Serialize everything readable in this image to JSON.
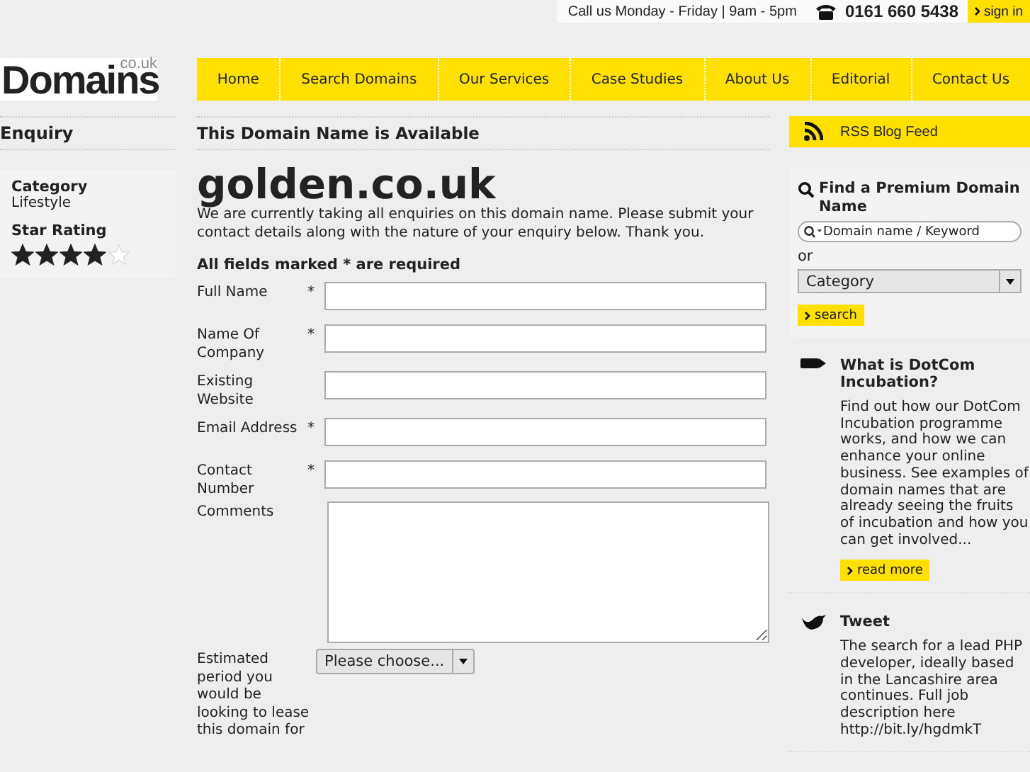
{
  "topbar": {
    "hours": "Call us Monday - Friday | 9am - 5pm",
    "phone": "0161 660 5438",
    "sign_in": "sign in"
  },
  "logo": {
    "main": "Domains",
    "suffix": "co.uk"
  },
  "nav": [
    {
      "label": "Home"
    },
    {
      "label": "Search Domains"
    },
    {
      "label": "Our Services"
    },
    {
      "label": "Case Studies"
    },
    {
      "label": "About Us"
    },
    {
      "label": "Editorial"
    },
    {
      "label": "Contact Us"
    }
  ],
  "sidebar": {
    "heading": "Enquiry",
    "category_label": "Category",
    "category": "Lifestyle",
    "rating_label": "Star Rating",
    "stars": 4
  },
  "main": {
    "heading": "This Domain Name is Available",
    "domain": "golden.co.uk",
    "intro": "We are currently taking all enquiries on this domain name. Please submit your contact details along with the nature of your enquiry below. Thank you.",
    "required_note": "All fields marked * are required",
    "fields": [
      {
        "kind": "text",
        "label": "Full Name",
        "required_mark": "*"
      },
      {
        "kind": "text",
        "label": "Name Of Company",
        "required_mark": "*"
      },
      {
        "kind": "text",
        "label": "Existing Website"
      },
      {
        "kind": "text",
        "label": "Email Address",
        "required_mark": "*"
      },
      {
        "kind": "text",
        "label": "Contact Number",
        "required_mark": "*"
      },
      {
        "kind": "textarea",
        "label": "Comments"
      },
      {
        "kind": "select",
        "label": "Estimated period you would be looking to lease this domain for",
        "value": "Please choose..."
      }
    ]
  },
  "right": {
    "rss": "RSS Blog Feed",
    "search_title": "Find a Premium Domain Name",
    "search_placeholder": "Domain name / Keyword",
    "or": "or",
    "category": "Category",
    "search_button": "search",
    "articles": [
      {
        "kind": "incubation",
        "title": "What is DotCom Incubation?",
        "body": "Find out how our DotCom Incubation programme works, and how we can enhance your online business. See examples of domain names that are already seeing the fruits of incubation and how you can get involved...",
        "button": "read more"
      },
      {
        "kind": "tweet",
        "title": "Tweet",
        "body": "The search for a lead PHP developer, ideally based in the Lancashire area continues. Full job description here http://bit.ly/hgdmkT"
      }
    ]
  }
}
